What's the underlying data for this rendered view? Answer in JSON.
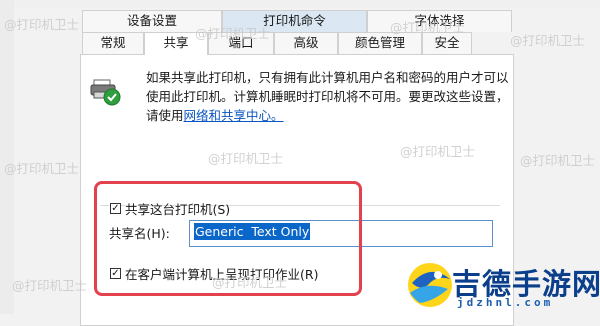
{
  "tabs": {
    "row1": [
      {
        "label": "设备设置"
      },
      {
        "label": "打印机命令"
      },
      {
        "label": "字体选择"
      }
    ],
    "row2": [
      {
        "label": "常规"
      },
      {
        "label": "共享"
      },
      {
        "label": "端口"
      },
      {
        "label": "高级"
      },
      {
        "label": "颜色管理"
      },
      {
        "label": "安全"
      }
    ]
  },
  "sharing": {
    "info_text": "如果共享此打印机，只有拥有此计算机用户名和密码的用户才可以使用此打印机。计算机睡眠时打印机将不可用。要更改这些设置，请使用",
    "info_link": "网络和共享中心。",
    "share_checkbox": {
      "label": "共享这台打印机(S)",
      "checked": true
    },
    "share_name": {
      "label": "共享名(H):",
      "value": "Generic  Text Only"
    },
    "render_checkbox": {
      "label": "在客户端计算机上呈现打印作业(R)",
      "checked": true
    }
  },
  "watermark": {
    "text": "@打印机卫士"
  },
  "logo": {
    "text": "吉德手游网",
    "url": "jdzhnl.com"
  }
}
